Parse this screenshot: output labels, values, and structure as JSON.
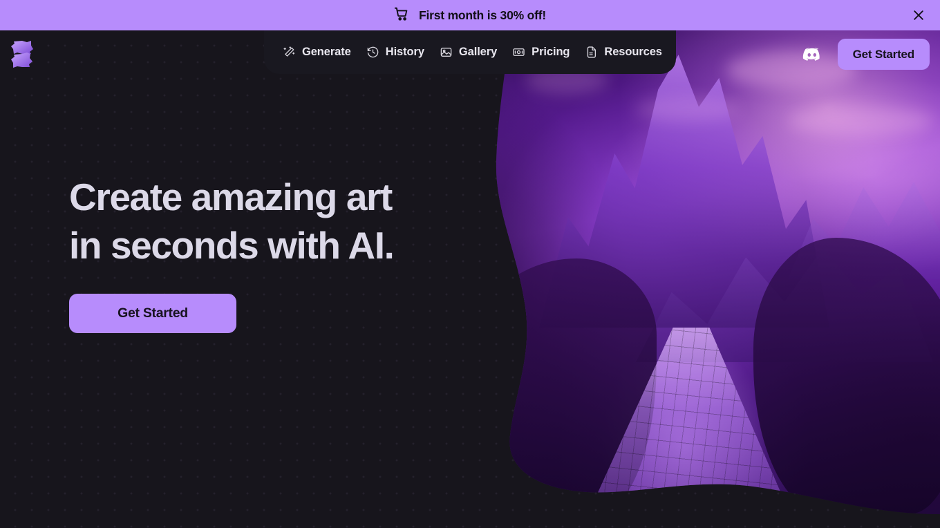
{
  "theme": {
    "accent": "#b78cfc",
    "background": "#17151c",
    "nav_surface": "#191820",
    "heading_color": "#dcd9e8",
    "on_accent": "#15121c"
  },
  "promo_banner": {
    "icon": "shopping-cart-icon",
    "message": "First month is 30% off!",
    "close_label": "✕"
  },
  "brand": {
    "logo_name": "app-logo",
    "logo_alt": "Abstract purple S-shaped logo"
  },
  "nav": {
    "items": [
      {
        "label": "Generate",
        "icon": "magic-wand-icon"
      },
      {
        "label": "History",
        "icon": "clock-history-icon"
      },
      {
        "label": "Gallery",
        "icon": "image-icon"
      },
      {
        "label": "Pricing",
        "icon": "banknote-icon"
      },
      {
        "label": "Resources",
        "icon": "document-icon"
      }
    ]
  },
  "nav_actions": {
    "discord_icon": "discord-icon",
    "get_started_label": "Get Started"
  },
  "hero": {
    "title": "Create amazing art\nin seconds with AI.",
    "cta_label": "Get Started",
    "artwork_alt": "Purple fantasy mountain landscape with a glowing stone path"
  }
}
